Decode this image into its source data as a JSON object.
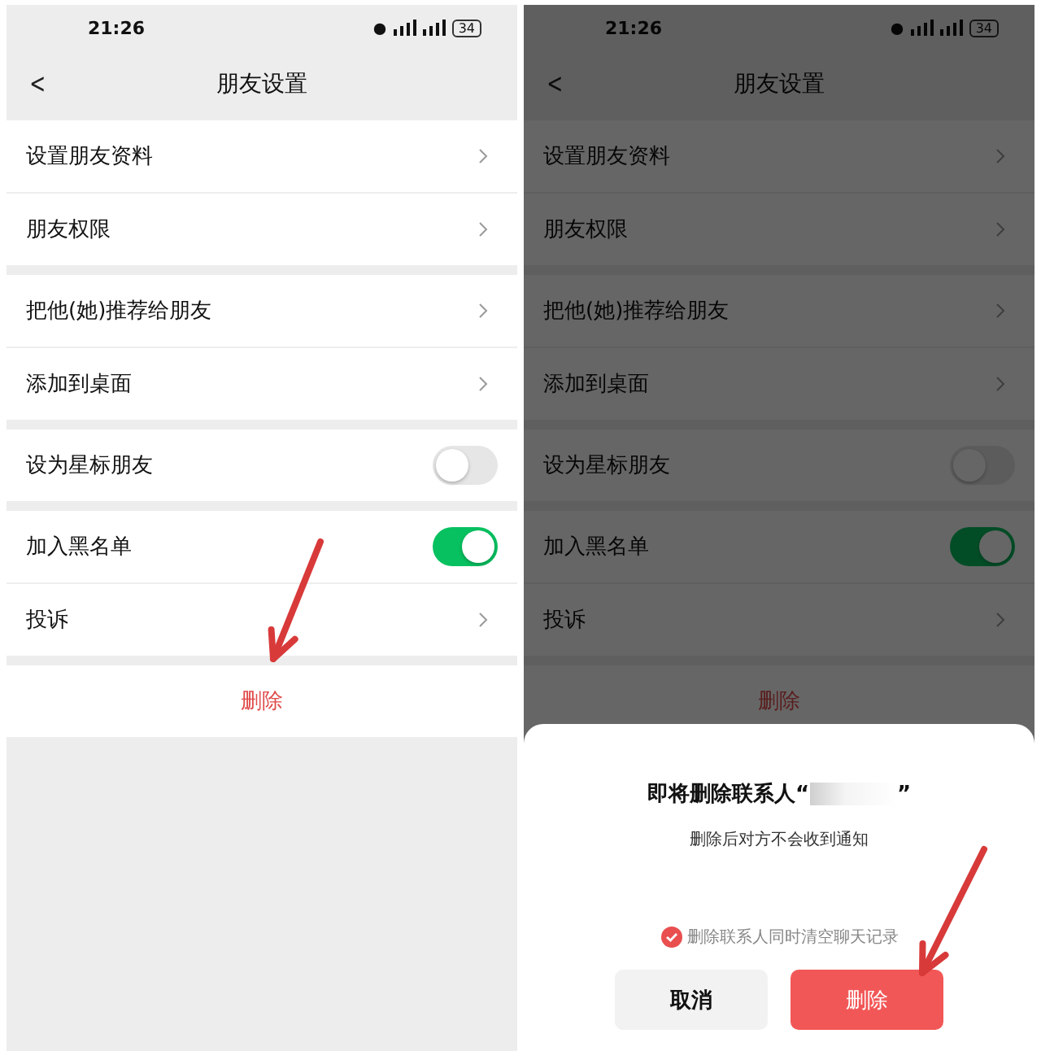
{
  "screens": [
    {
      "dimmed": false,
      "status_bar": {
        "time": "21:26",
        "battery": "34"
      },
      "nav": {
        "back": "<",
        "title": "朋友设置"
      },
      "groups": [
        [
          {
            "kind": "link",
            "label": "设置朋友资料"
          },
          {
            "kind": "link",
            "label": "朋友权限"
          }
        ],
        [
          {
            "kind": "link",
            "label": "把他(她)推荐给朋友"
          },
          {
            "kind": "link",
            "label": "添加到桌面"
          }
        ],
        [
          {
            "kind": "toggle",
            "label": "设为星标朋友",
            "on": false
          }
        ],
        [
          {
            "kind": "toggle",
            "label": "加入黑名单",
            "on": true
          },
          {
            "kind": "link",
            "label": "投诉"
          }
        ],
        [
          {
            "kind": "danger",
            "label": "删除"
          }
        ]
      ],
      "arrow": {
        "kind": "to-delete-row"
      }
    },
    {
      "dimmed": true,
      "status_bar": {
        "time": "21:26",
        "battery": "34"
      },
      "nav": {
        "back": "<",
        "title": "朋友设置"
      },
      "groups": [
        [
          {
            "kind": "link",
            "label": "设置朋友资料"
          },
          {
            "kind": "link",
            "label": "朋友权限"
          }
        ],
        [
          {
            "kind": "link",
            "label": "把他(她)推荐给朋友"
          },
          {
            "kind": "link",
            "label": "添加到桌面"
          }
        ],
        [
          {
            "kind": "toggle",
            "label": "设为星标朋友",
            "on": false
          }
        ],
        [
          {
            "kind": "toggle",
            "label": "加入黑名单",
            "on": true
          },
          {
            "kind": "link",
            "label": "投诉"
          }
        ],
        [
          {
            "kind": "danger",
            "label": "删除"
          }
        ]
      ],
      "dialog": {
        "title": "即将删除联系人“",
        "title_end": "”",
        "message": "删除后对方不会收到通知",
        "option": {
          "label": "删除联系人同时清空聊天记录",
          "checked": true
        },
        "buttons": [
          {
            "kind": "cancel",
            "label": "取消"
          },
          {
            "kind": "confirm",
            "label": "删除"
          }
        ]
      },
      "arrow": {
        "kind": "to-confirm-button"
      }
    }
  ]
}
